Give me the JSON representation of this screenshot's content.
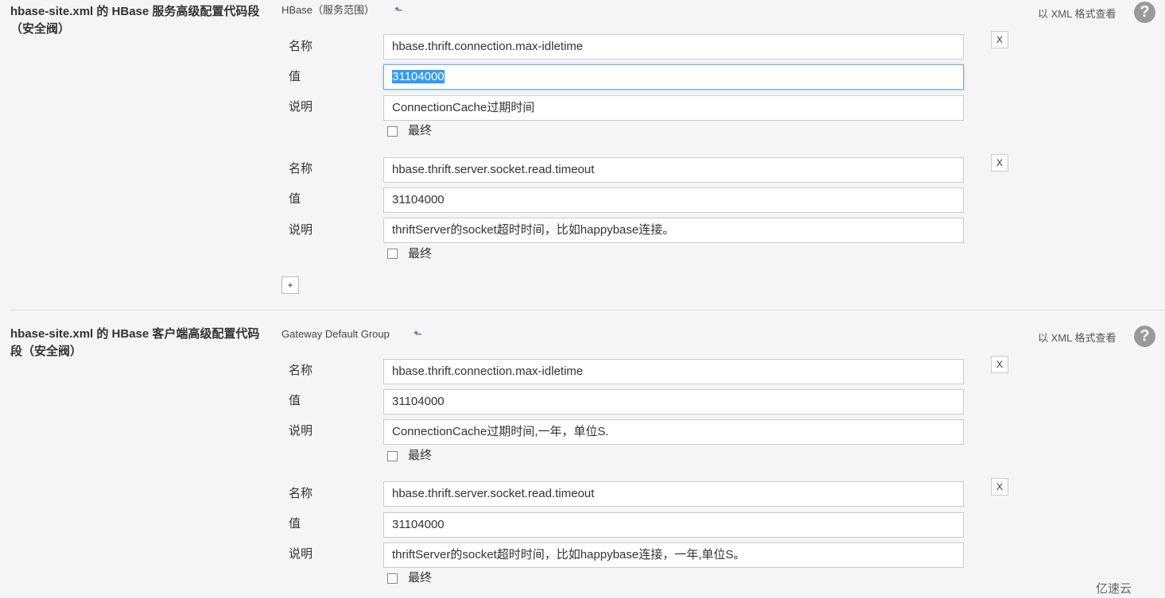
{
  "sections": [
    {
      "title": "hbase-site.xml 的 HBase 服务高级配置代码段（安全阀）",
      "scope": "HBase（服务范围）",
      "xml_link": "以 XML 格式查看",
      "entries": [
        {
          "name": "hbase.thrift.connection.max-idletime",
          "value": "31104000",
          "desc": "ConnectionCache过期时间",
          "final": "最终"
        },
        {
          "name": "hbase.thrift.server.socket.read.timeout",
          "value": "31104000",
          "desc": "thriftServer的socket超时时间，比如happybase连接。",
          "final": "最终"
        }
      ]
    },
    {
      "title": "hbase-site.xml 的 HBase 客户端高级配置代码段（安全阀）",
      "scope": "Gateway Default Group",
      "xml_link": "以 XML 格式查看",
      "entries": [
        {
          "name": "hbase.thrift.connection.max-idletime",
          "value": "31104000",
          "desc": "ConnectionCache过期时间,一年，单位S.",
          "final": "最终"
        },
        {
          "name": "hbase.thrift.server.socket.read.timeout",
          "value": "31104000",
          "desc": "thriftServer的socket超时时间，比如happybase连接，一年,单位S。",
          "final": "最终"
        }
      ]
    }
  ],
  "labels": {
    "name": "名称",
    "value": "值",
    "desc": "说明"
  },
  "remove_label": "X",
  "add_label": "+",
  "help_label": "?",
  "scope_arrow": "⬑",
  "watermark": "亿速云"
}
